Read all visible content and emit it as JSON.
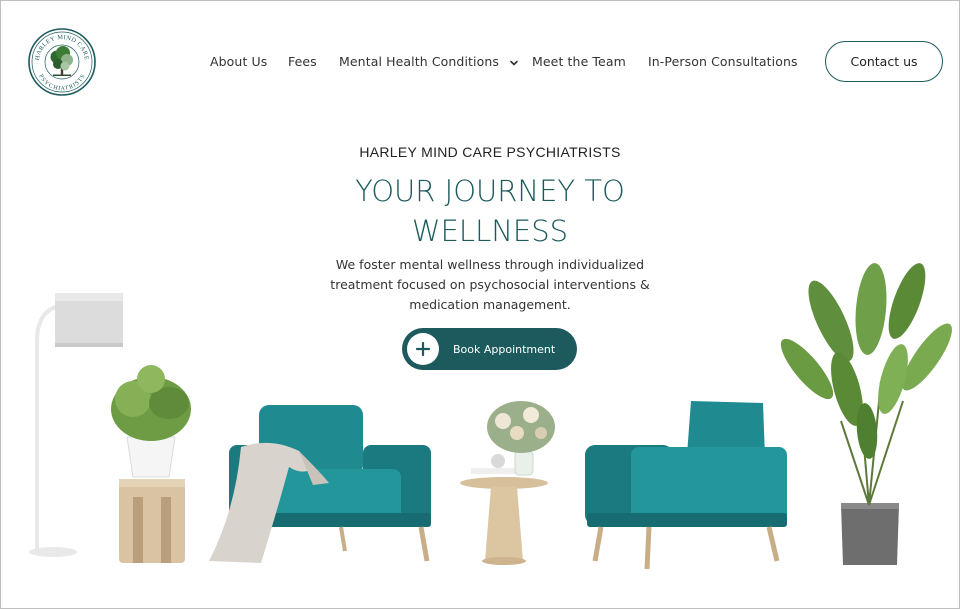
{
  "header": {
    "logo": {
      "icon": "tree-logo-icon",
      "text_top": "HARLEY MIND CARE",
      "text_bottom": "PSYCHIATRISTS"
    },
    "nav": [
      {
        "label": "About Us"
      },
      {
        "label": "Fees"
      },
      {
        "label": "Mental Health Conditions",
        "icon": "chevron-down-icon"
      },
      {
        "label": "Meet the Team"
      },
      {
        "label": "In-Person Consultations"
      }
    ],
    "contact_label": "Contact us"
  },
  "hero": {
    "eyebrow": "HARLEY MIND CARE PSYCHIATRISTS",
    "title_lines": [
      "YOUR JOURNEY TO",
      "WELLNESS"
    ],
    "description_lines": [
      "We foster mental wellness through individualized",
      "treatment focused on psychosocial interventions &",
      "medication management."
    ],
    "cta_label": "Book Appointment",
    "cta_icon": "plus-icon"
  },
  "colors": {
    "brand_teal": "#1d5a5d",
    "chair_teal": "#1f8a8f",
    "text_dark": "#333333"
  }
}
